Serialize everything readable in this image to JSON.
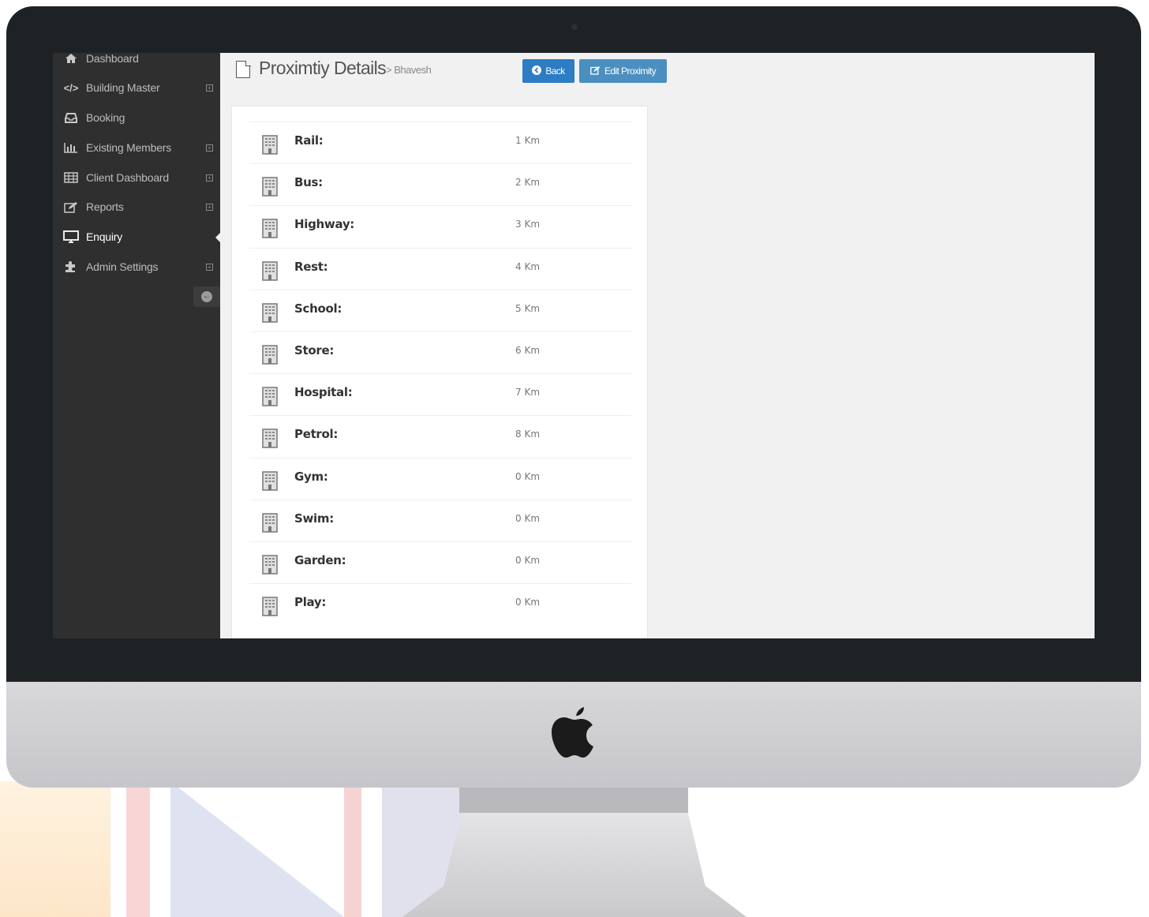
{
  "sidebar": {
    "items": [
      {
        "label": "Dashboard",
        "icon": "home-icon"
      },
      {
        "label": "Building Master",
        "icon": "code-icon"
      },
      {
        "label": "Booking",
        "icon": "inbox-icon"
      },
      {
        "label": "Existing Members",
        "icon": "bar-chart-icon"
      },
      {
        "label": "Client Dashboard",
        "icon": "table-icon"
      },
      {
        "label": "Reports",
        "icon": "edit-icon"
      },
      {
        "label": "Enquiry",
        "icon": "desktop-icon"
      },
      {
        "label": "Admin Settings",
        "icon": "puzzle-icon"
      }
    ],
    "active": "Enquiry"
  },
  "header": {
    "title": "Proximtiy Details",
    "subtitle": "> Bhavesh",
    "back_label": "Back",
    "edit_label": "Edit Proximity"
  },
  "proximity": [
    {
      "label": "Rail:",
      "value": "1 Km"
    },
    {
      "label": "Bus:",
      "value": "2 Km"
    },
    {
      "label": "Highway:",
      "value": "3 Km"
    },
    {
      "label": "Rest:",
      "value": "4 Km"
    },
    {
      "label": "School:",
      "value": "5 Km"
    },
    {
      "label": "Store:",
      "value": "6 Km"
    },
    {
      "label": "Hospital:",
      "value": "7 Km"
    },
    {
      "label": "Petrol:",
      "value": "8 Km"
    },
    {
      "label": "Gym:",
      "value": "0 Km"
    },
    {
      "label": "Swim:",
      "value": "0 Km"
    },
    {
      "label": "Garden:",
      "value": "0 Km"
    },
    {
      "label": "Play:",
      "value": "0 Km"
    }
  ],
  "colors": {
    "sidebar_bg": "#2f2f2f",
    "back_button": "#2d7cc4",
    "edit_button": "#4a8fbf",
    "bezel": "#1f2224"
  }
}
